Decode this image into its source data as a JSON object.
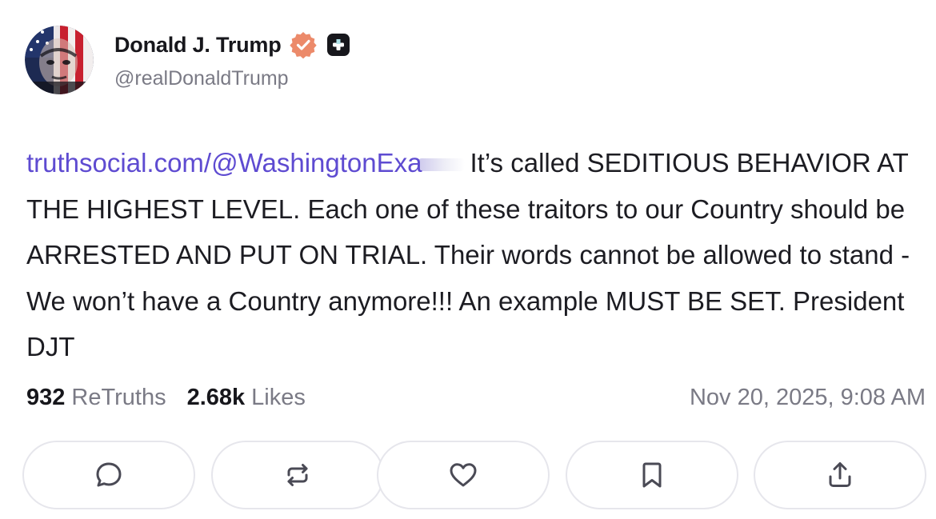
{
  "author": {
    "name": "Donald J. Trump",
    "handle": "@realDonaldTrump",
    "avatar": "avatar-flag-face",
    "verified_icon": "verified-badge-icon",
    "verified_color": "#e8845f",
    "plus_badge_icon": "plus-badge-icon"
  },
  "post": {
    "link_text": "truthsocial.com/@WashingtonExa",
    "link_color": "#5e4bd1",
    "text": "It’s called SEDITIOUS BEHAVIOR AT THE HIGHEST LEVEL. Each one of these traitors to our Country should be ARRESTED AND PUT ON TRIAL. Their words cannot be allowed to stand - We won’t have a Country anymore!!! An example MUST BE SET. President DJT"
  },
  "stats": {
    "retruths_count": "932",
    "retruths_label": "ReTruths",
    "likes_count": "2.68k",
    "likes_label": "Likes",
    "timestamp": "Nov 20, 2025, 9:08 AM"
  },
  "actions": [
    {
      "name": "reply",
      "icon": "comment-icon"
    },
    {
      "name": "retruth",
      "icon": "repost-icon"
    },
    {
      "name": "like",
      "icon": "heart-icon"
    },
    {
      "name": "bookmark",
      "icon": "bookmark-icon"
    },
    {
      "name": "share",
      "icon": "share-icon"
    }
  ]
}
